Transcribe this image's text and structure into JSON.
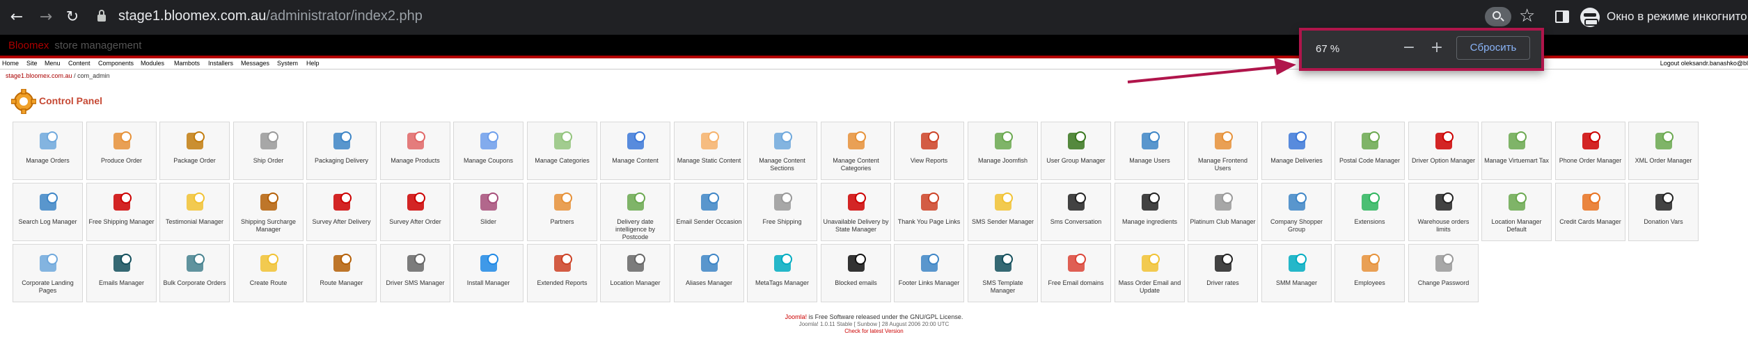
{
  "browser": {
    "url_host": "stage1.bloomex.com.au",
    "url_path": "/administrator/index2.php",
    "incognito_label": "Окно в режиме инкогнито"
  },
  "header": {
    "brand": "Bloomex",
    "subtitle": "store management"
  },
  "menu": {
    "items": [
      "Home",
      "Site",
      "Menu",
      "Content",
      "Components",
      "Modules",
      "Mambots",
      "Installers",
      "Messages",
      "System",
      "Help"
    ],
    "right_text": "Logout oleksandr.banashko@bl"
  },
  "breadcrumb": {
    "site": "stage1.bloomex.com.au",
    "rest": "/ com_admin"
  },
  "page_title": "Control Panel",
  "tiles": [
    {
      "label": "Manage Orders",
      "icon": "orders-icon",
      "color": "#6fa8dc"
    },
    {
      "label": "Produce Order",
      "icon": "produce-order-icon",
      "color": "#e69138"
    },
    {
      "label": "Package Order",
      "icon": "package-icon",
      "color": "#c27c0e"
    },
    {
      "label": "Ship Order",
      "icon": "truck-icon",
      "color": "#999999"
    },
    {
      "label": "Packaging Delivery",
      "icon": "books-icon",
      "color": "#3d85c6"
    },
    {
      "label": "Manage Products",
      "icon": "products-icon",
      "color": "#e06666"
    },
    {
      "label": "Manage Coupons",
      "icon": "coupons-icon",
      "color": "#6d9eeb"
    },
    {
      "label": "Manage Categories",
      "icon": "categories-icon",
      "color": "#93c47d"
    },
    {
      "label": "Manage Content",
      "icon": "content-icon",
      "color": "#3c78d8"
    },
    {
      "label": "Manage Static Content",
      "icon": "static-content-icon",
      "color": "#f6b26b"
    },
    {
      "label": "Manage Content Sections",
      "icon": "sections-icon",
      "color": "#6fa8dc"
    },
    {
      "label": "Manage Content Categories",
      "icon": "content-categories-icon",
      "color": "#e69138"
    },
    {
      "label": "View Reports",
      "icon": "reports-icon",
      "color": "#cc4125"
    },
    {
      "label": "Manage Joomfish",
      "icon": "joomfish-icon",
      "color": "#6aa84f"
    },
    {
      "label": "User Group Manager",
      "icon": "user-group-icon",
      "color": "#38761d"
    },
    {
      "label": "Manage Users",
      "icon": "users-icon",
      "color": "#3d85c6"
    },
    {
      "label": "Manage Frontend Users",
      "icon": "frontend-users-icon",
      "color": "#e69138"
    },
    {
      "label": "Manage Deliveries",
      "icon": "calendar-icon",
      "color": "#3c78d8"
    },
    {
      "label": "Postal Code Manager",
      "icon": "postal-code-icon",
      "color": "#6aa84f"
    },
    {
      "label": "Driver Option Manager",
      "icon": "car-icon",
      "color": "#cc0000"
    },
    {
      "label": "Manage Virtuemart Tax",
      "icon": "dollar-icon",
      "color": "#6aa84f"
    },
    {
      "label": "Phone Order Manager",
      "icon": "phone-icon",
      "color": "#cc0000"
    },
    {
      "label": "XML Order Manager",
      "icon": "xml-icon",
      "color": "#6aa84f"
    },
    {
      "label": "Search Log Manager",
      "icon": "search-log-icon",
      "color": "#3d85c6"
    },
    {
      "label": "Free Shipping Manager",
      "icon": "free-shipping-icon",
      "color": "#cc0000"
    },
    {
      "label": "Testimonial Manager",
      "icon": "pencil-icon",
      "color": "#f1c232"
    },
    {
      "label": "Shipping Surcharge Manager",
      "icon": "box-icon",
      "color": "#b45f06"
    },
    {
      "label": "Survey After Delivery",
      "icon": "survey-delivery-icon",
      "color": "#cc0000"
    },
    {
      "label": "Survey After Order",
      "icon": "survey-order-icon",
      "color": "#cc0000"
    },
    {
      "label": "Slider",
      "icon": "slider-icon",
      "color": "#a64d79"
    },
    {
      "label": "Partners",
      "icon": "handshake-icon",
      "color": "#e69138"
    },
    {
      "label": "Delivery date intelligence by Postcode",
      "icon": "delivery-date-icon",
      "color": "#6aa84f"
    },
    {
      "label": "Email Sender Occasion",
      "icon": "email-sender-icon",
      "color": "#3d85c6"
    },
    {
      "label": "Free Shipping",
      "icon": "free-truck-icon",
      "color": "#999999"
    },
    {
      "label": "Unavailable Delivery by State Manager",
      "icon": "unavailable-delivery-icon",
      "color": "#cc0000"
    },
    {
      "label": "Thank You Page Links",
      "icon": "thank-you-icon",
      "color": "#cc4125"
    },
    {
      "label": "SMS Sender Manager",
      "icon": "sms-sender-icon",
      "color": "#f1c232"
    },
    {
      "label": "Sms Conversation",
      "icon": "sms-conversation-icon",
      "color": "#222222"
    },
    {
      "label": "Manage ingredients",
      "icon": "ingredients-list-icon",
      "color": "#222222"
    },
    {
      "label": "Platinum Club Manager",
      "icon": "platinum-club-icon",
      "color": "#999999"
    },
    {
      "label": "Company Shopper Group",
      "icon": "company-group-icon",
      "color": "#3d85c6"
    },
    {
      "label": "Extensions",
      "icon": "extensions-phone-icon",
      "color": "#2db55d"
    },
    {
      "label": "Warehouse orders limits",
      "icon": "checklist-icon",
      "color": "#222222"
    },
    {
      "label": "Location Manager Default",
      "icon": "location-default-icon",
      "color": "#6aa84f"
    },
    {
      "label": "Credit Cards Manager",
      "icon": "credit-card-icon",
      "color": "#e8711f"
    },
    {
      "label": "Donation Vars",
      "icon": "list-circle-icon",
      "color": "#222222"
    },
    {
      "label": "Corporate Landing Pages",
      "icon": "corporate-icon",
      "color": "#6fa8dc"
    },
    {
      "label": "Emails Manager",
      "icon": "emails-icon",
      "color": "#134f5c"
    },
    {
      "label": "Bulk Corporate Orders",
      "icon": "bulk-orders-icon",
      "color": "#45818e"
    },
    {
      "label": "Create Route",
      "icon": "route-icon",
      "color": "#f1c232"
    },
    {
      "label": "Route Manager",
      "icon": "route-manager-icon",
      "color": "#b45f06"
    },
    {
      "label": "Driver SMS Manager",
      "icon": "driver-sms-icon",
      "color": "#666666"
    },
    {
      "label": "Install Manager",
      "icon": "install-icon",
      "color": "#1e88e5"
    },
    {
      "label": "Extended Reports",
      "icon": "extended-reports-icon",
      "color": "#cc4125"
    },
    {
      "label": "Location Manager",
      "icon": "location-icon",
      "color": "#666666"
    },
    {
      "label": "Aliases Manager",
      "icon": "aliases-icon",
      "color": "#3d85c6"
    },
    {
      "label": "MetaTags Manager",
      "icon": "metatags-icon",
      "color": "#00acc1"
    },
    {
      "label": "Blocked emails",
      "icon": "blocked-emails-icon",
      "color": "#111111"
    },
    {
      "label": "Footer Links Manager",
      "icon": "link-icon",
      "color": "#3d85c6"
    },
    {
      "label": "SMS Template Manager",
      "icon": "sms-template-icon",
      "color": "#134f5c"
    },
    {
      "label": "Free Email domains",
      "icon": "gmail-icon",
      "color": "#db4437"
    },
    {
      "label": "Mass Order Email and Update",
      "icon": "mass-email-icon",
      "color": "#f1c232"
    },
    {
      "label": "Driver rates",
      "icon": "driver-rates-icon",
      "color": "#222222"
    },
    {
      "label": "SMM Manager",
      "icon": "smm-icon",
      "color": "#00acc1"
    },
    {
      "label": "Employees",
      "icon": "employees-icon",
      "color": "#e69138"
    },
    {
      "label": "Change Password",
      "icon": "key-icon",
      "color": "#999999"
    }
  ],
  "footer": {
    "joomla": "Joomla!",
    "line1_rest": " is Free Software released under the GNU/GPL License.",
    "line2": "Joomla! 1.0.11 Stable [ Sunbow ] 28 August 2006 20:00 UTC",
    "line3": "Check for latest Version"
  },
  "zoom_popup": {
    "percent": "67 %",
    "minus": "−",
    "plus": "+",
    "reset": "Сбросить"
  },
  "annotation_color": "#b0154b"
}
